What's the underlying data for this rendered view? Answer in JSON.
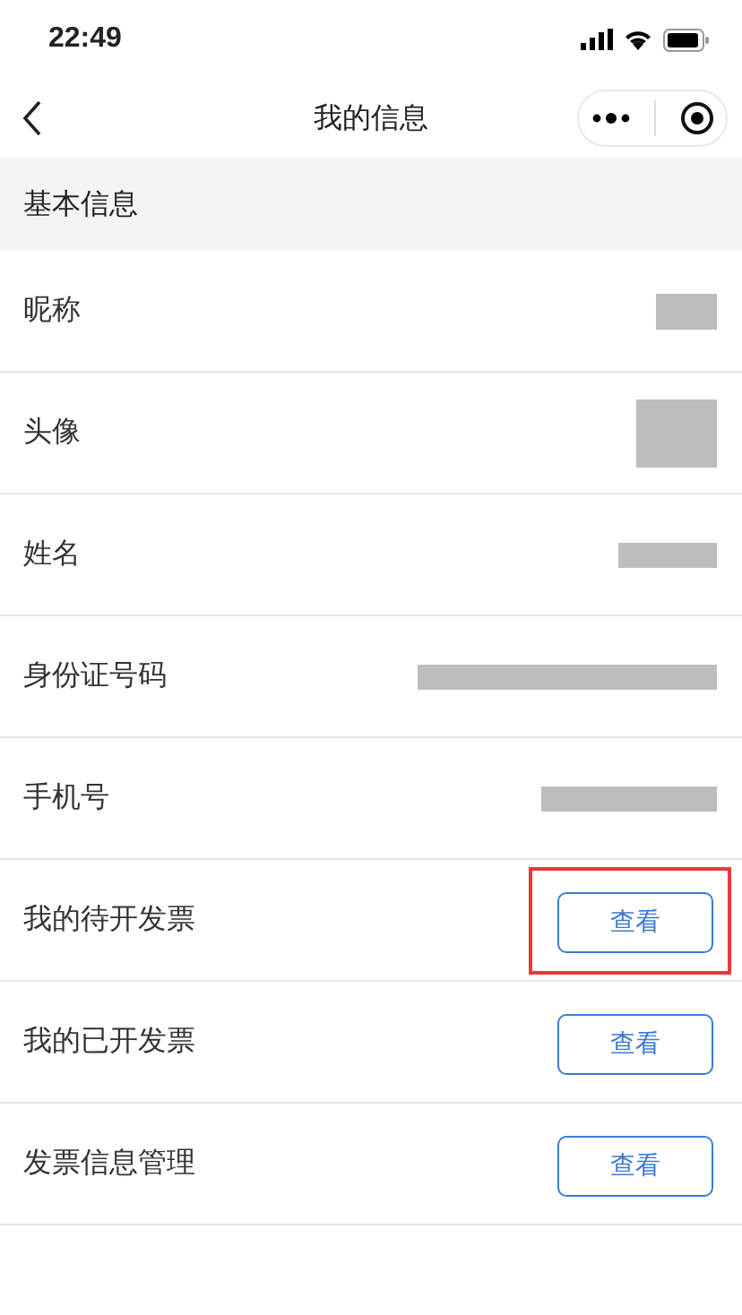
{
  "status_bar": {
    "time": "22:49"
  },
  "nav": {
    "title": "我的信息"
  },
  "section": {
    "title": "基本信息"
  },
  "rows": [
    {
      "label": "昵称",
      "kind": "redacted"
    },
    {
      "label": "头像",
      "kind": "redacted"
    },
    {
      "label": "姓名",
      "kind": "redacted"
    },
    {
      "label": "身份证号码",
      "kind": "redacted"
    },
    {
      "label": "手机号",
      "kind": "redacted"
    },
    {
      "label": "我的待开发票",
      "kind": "button",
      "button": "查看",
      "highlighted": true
    },
    {
      "label": "我的已开发票",
      "kind": "button",
      "button": "查看",
      "highlighted": false
    },
    {
      "label": "发票信息管理",
      "kind": "button",
      "button": "查看",
      "highlighted": false
    }
  ]
}
